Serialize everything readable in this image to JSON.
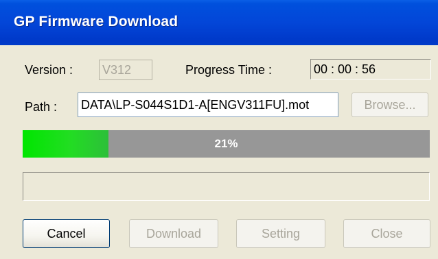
{
  "window": {
    "title": "GP Firmware Download"
  },
  "form": {
    "version_label": "Version :",
    "version_value": "V312",
    "progress_time_label": "Progress Time :",
    "progress_time_value": "00 : 00 : 56",
    "path_label": "Path :",
    "path_value": "DATA\\LP-S044S1D1-A[ENGV311FU].mot",
    "browse_label": "Browse..."
  },
  "progress": {
    "percent": 21,
    "text": "21%"
  },
  "status": {
    "text": ""
  },
  "buttons": {
    "cancel": "Cancel",
    "download": "Download",
    "setting": "Setting",
    "close": "Close"
  },
  "colors": {
    "title_bar": "#0346d8",
    "progress_fill": "#22dd22",
    "progress_track": "#979797",
    "dialog_bg": "#ece9d8"
  }
}
